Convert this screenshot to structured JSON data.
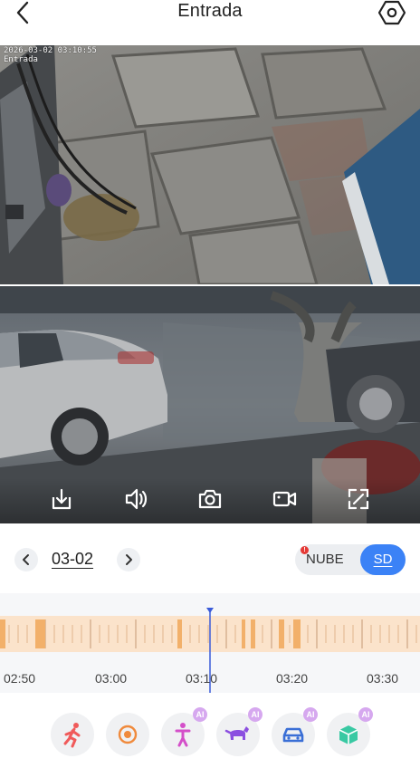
{
  "header": {
    "title": "Entrada",
    "back_icon": "chevron-left-icon",
    "settings_icon": "hexagon-gear-icon"
  },
  "camera1": {
    "timestamp": "2026-03-02 03:10:55",
    "channel_name": "Entrada"
  },
  "controls": [
    {
      "name": "download-icon"
    },
    {
      "name": "speaker-icon"
    },
    {
      "name": "camera-snapshot-icon"
    },
    {
      "name": "record-video-icon"
    },
    {
      "name": "fullscreen-icon"
    }
  ],
  "date_bar": {
    "date": "03-02",
    "prev_icon": "chevron-left-icon",
    "next_icon": "chevron-right-icon"
  },
  "storage": {
    "options": [
      "NUBE",
      "SD"
    ],
    "selected": "SD",
    "alert_mark": "!"
  },
  "timeline": {
    "labels": [
      "02:50",
      "03:00",
      "03:10",
      "03:20",
      "03:30"
    ],
    "current_time": "03:10:55"
  },
  "filters": [
    {
      "name": "motion-person-running-icon",
      "ai": false
    },
    {
      "name": "all-events-target-icon",
      "ai": false
    },
    {
      "name": "human-detection-icon",
      "ai": true,
      "badge": "AI"
    },
    {
      "name": "pet-detection-icon",
      "ai": true,
      "badge": "AI"
    },
    {
      "name": "vehicle-detection-icon",
      "ai": true,
      "badge": "AI"
    },
    {
      "name": "package-detection-icon",
      "ai": true,
      "badge": "AI"
    }
  ],
  "colors": {
    "accent": "#3b82f6",
    "timeline_event": "#f7c28f",
    "timeline_cursor": "#3a5bd9",
    "ai_badge": "#d6a8ef"
  }
}
